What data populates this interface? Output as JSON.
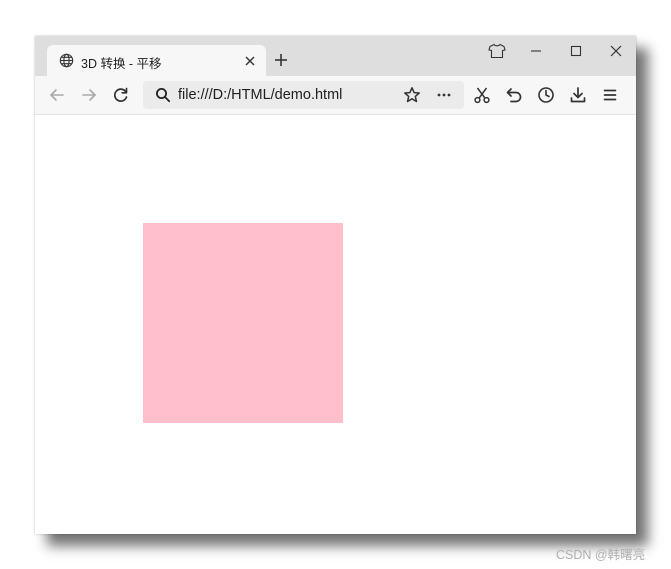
{
  "browser": {
    "tab": {
      "title": "3D 转换 - 平移",
      "icon": "globe-icon"
    },
    "address_bar": {
      "url": "file:///D:/HTML/demo.html"
    }
  },
  "page": {
    "box_color": "#FFC0CB"
  },
  "watermark": "CSDN @韩曙亮"
}
